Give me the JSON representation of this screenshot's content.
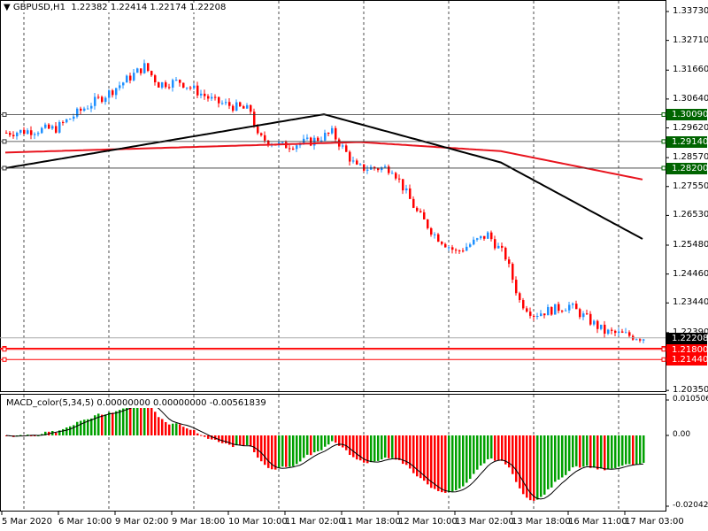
{
  "header": {
    "symbol": "GBPUSD,H1",
    "open": "1.22382",
    "high": "1.22414",
    "low": "1.22174",
    "close": "1.22208"
  },
  "macd": {
    "label": "MACD_color(5,34,5)",
    "v1": "0.00000000",
    "v2": "0.00000000",
    "v3": "-0.00561839",
    "axis_top": "0.0105061",
    "axis_zero": "0.00",
    "axis_bottom": "-0.020421"
  },
  "price_axis": [
    "1.33730",
    "1.32710",
    "1.31660",
    "1.30640",
    "1.29620",
    "1.28570",
    "1.27550",
    "1.26530",
    "1.25480",
    "1.24460",
    "1.23440",
    "1.22390",
    "1.20350"
  ],
  "levels": {
    "green": [
      "1.30090",
      "1.29140",
      "1.28200"
    ],
    "red": [
      "1.21800",
      "1.21440"
    ],
    "red_hidden": "1.21840",
    "current": "1.22208"
  },
  "time_axis": [
    "5 Mar 2020",
    "6 Mar 10:00",
    "9 Mar 02:00",
    "9 Mar 18:00",
    "10 Mar 10:00",
    "11 Mar 02:00",
    "11 Mar 18:00",
    "12 Mar 10:00",
    "13 Mar 02:00",
    "13 Mar 18:00",
    "16 Mar 11:00",
    "17 Mar 03:00"
  ],
  "colors": {
    "bull": "#1e90ff",
    "bear": "#ff0000",
    "level_tag": "#006400",
    "red_tag": "#ff0000",
    "macd_up": "#00a000",
    "macd_down": "#ff0000"
  },
  "chart_data": {
    "type": "candlestick",
    "ylim": [
      1.2035,
      1.3373
    ],
    "close_path": [
      [
        0,
        1.2945
      ],
      [
        14,
        1.296
      ],
      [
        22,
        1.3032
      ],
      [
        29,
        1.3086
      ],
      [
        39,
        1.3179
      ],
      [
        43,
        1.3117
      ],
      [
        49,
        1.3126
      ],
      [
        59,
        1.3054
      ],
      [
        69,
        1.3023
      ],
      [
        71,
        1.2929
      ],
      [
        78,
        1.2898
      ],
      [
        86,
        1.2914
      ],
      [
        92,
        1.2945
      ],
      [
        99,
        1.282
      ],
      [
        109,
        1.282
      ],
      [
        116,
        1.2664
      ],
      [
        121,
        1.2585
      ],
      [
        127,
        1.2523
      ],
      [
        136,
        1.2585
      ],
      [
        141,
        1.2507
      ],
      [
        145,
        1.2351
      ],
      [
        149,
        1.2304
      ],
      [
        159,
        1.2335
      ],
      [
        169,
        1.2242
      ],
      [
        180,
        1.2221
      ]
    ],
    "ma_black": [
      [
        0,
        1.282
      ],
      [
        90,
        1.301
      ],
      [
        140,
        1.284
      ],
      [
        180,
        1.257
      ]
    ],
    "ma_red": [
      [
        0,
        1.2875
      ],
      [
        100,
        1.2912
      ],
      [
        140,
        1.288
      ],
      [
        180,
        1.278
      ]
    ]
  }
}
